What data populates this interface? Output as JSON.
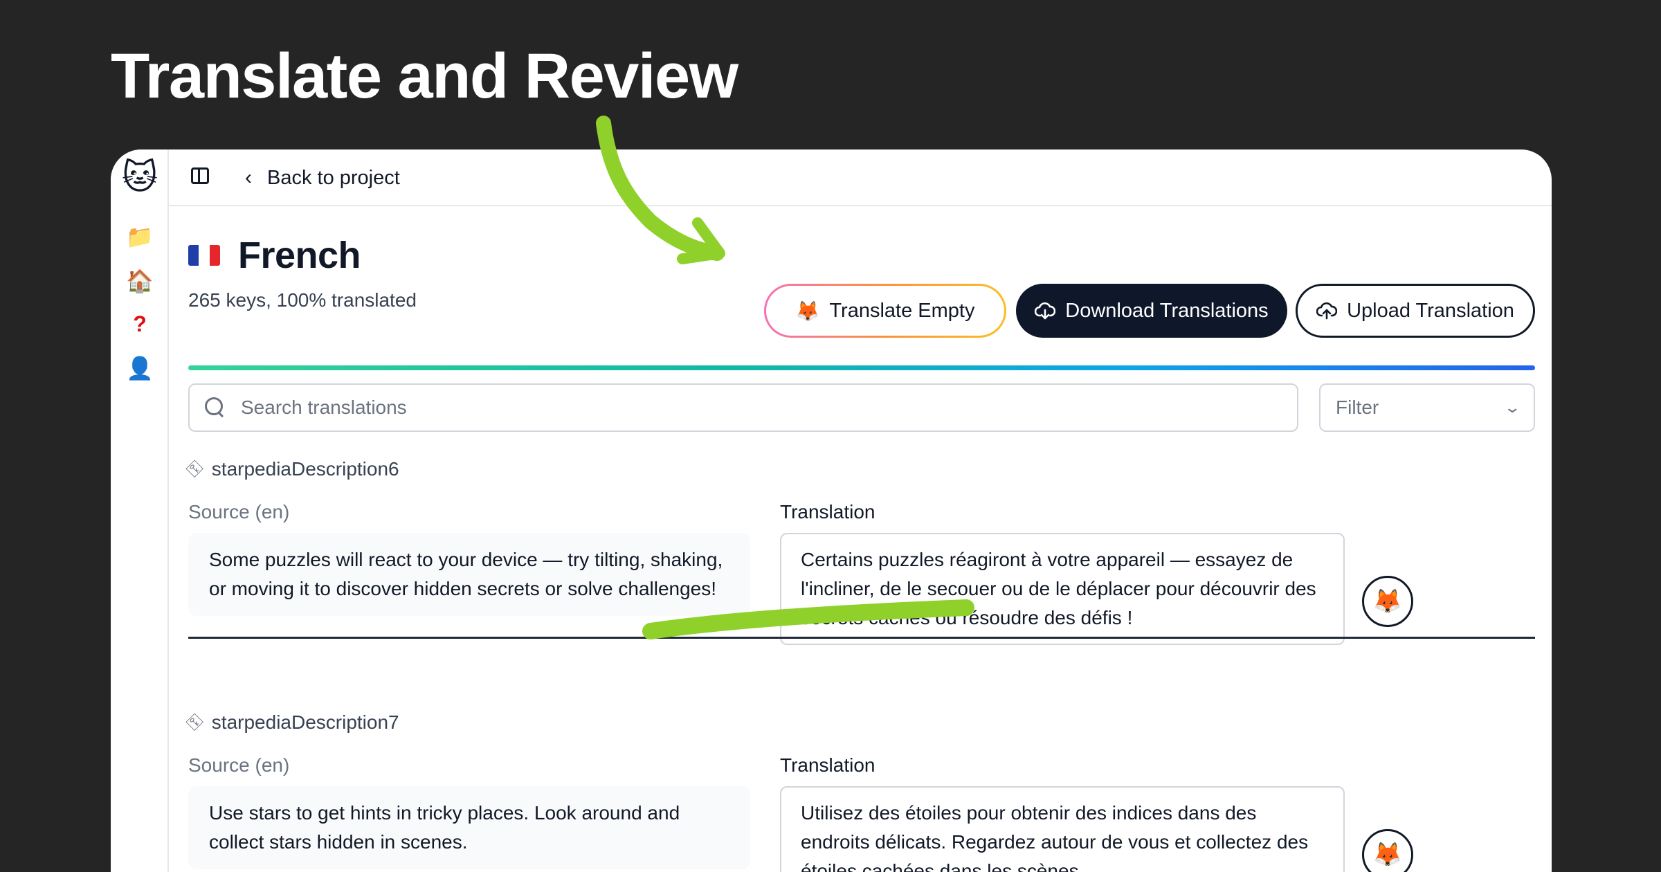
{
  "headline": "Translate and Review",
  "topbar": {
    "back_label": "Back to project"
  },
  "language": {
    "name": "French",
    "stats": "265 keys, 100% translated",
    "progress": 1.0
  },
  "actions": {
    "translate_empty": "Translate Empty",
    "download": "Download Translations",
    "upload": "Upload Translation"
  },
  "search": {
    "placeholder": "Search translations"
  },
  "filter": {
    "value": "Filter"
  },
  "entries": [
    {
      "key": "starpediaDescription6",
      "source_label": "Source (en)",
      "translation_label": "Translation",
      "source": "Some puzzles will react to your device — try tilting, shaking, or moving it to discover hidden secrets or solve challenges!",
      "translation": "Certains puzzles réagiront à votre appareil — essayez de l'incliner, de le secouer ou de le déplacer pour découvrir des secrets cachés ou résoudre des défis !"
    },
    {
      "key": "starpediaDescription7",
      "source_label": "Source (en)",
      "translation_label": "Translation",
      "source": "Use stars to get hints in tricky places. Look around and collect stars hidden in scenes.",
      "translation": "Utilisez des étoiles pour obtenir des indices dans des endroits délicats. Regardez autour de vous et collectez des étoiles cachées dans les scènes."
    }
  ],
  "icons": {
    "logo": "cat-logo",
    "rail": [
      "folder-icon",
      "home-icon",
      "help-icon",
      "user-icon"
    ],
    "ai": "fox-icon"
  },
  "colors": {
    "background": "#252525",
    "accent_scribble": "#8fd12a",
    "primary_button": "#0f172a"
  }
}
